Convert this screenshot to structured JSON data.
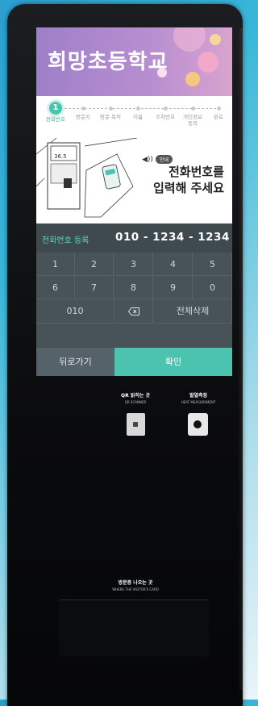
{
  "banner": {
    "school_name": "희망초등학교"
  },
  "steps": [
    {
      "number": "1",
      "label": "전화번호",
      "active": true
    },
    {
      "label": "방문지"
    },
    {
      "label": "방문 목적"
    },
    {
      "label": "이름"
    },
    {
      "label": "주차번호"
    },
    {
      "label": "개인정보\n동의"
    },
    {
      "label": "완료"
    }
  ],
  "guide": {
    "notice_badge": "안내",
    "prompt_line1": "전화번호를",
    "prompt_line2": "입력해 주세요",
    "illustration_readout": "36.5"
  },
  "phone": {
    "label": "전화번호 등록",
    "value": "010 - 1234 - 1234"
  },
  "keypad": {
    "keys": [
      "1",
      "2",
      "3",
      "4",
      "5",
      "6",
      "7",
      "8",
      "9",
      "0"
    ],
    "prefix": "010",
    "backspace_icon": "backspace-icon",
    "clear_all": "전체삭제"
  },
  "buttons": {
    "back": "뒤로가기",
    "confirm": "확인"
  },
  "hardware": {
    "qr_label": "QR 읽히는 곳",
    "qr_sub": "QR SCANNER",
    "heat_label": "발열측정",
    "heat_sub": "HEAT MEASUREMENT",
    "card_label": "방문증 나오는 곳",
    "card_sub": "WHERE THE VISITOR'S CARD"
  },
  "colors": {
    "accent": "#4cc3ae",
    "banner": "#b88fd0",
    "keypad": "#485357"
  }
}
